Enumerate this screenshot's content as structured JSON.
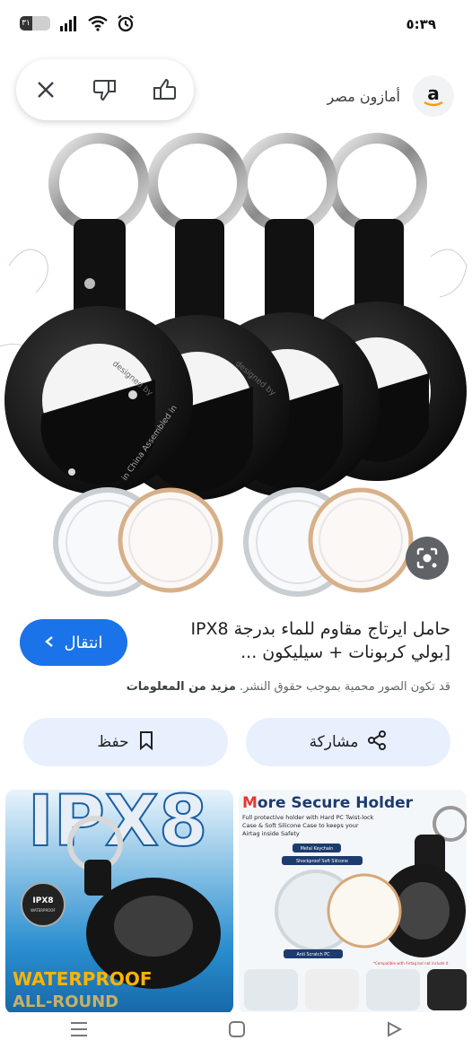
{
  "status_bar": {
    "time": "٥:٣٩",
    "battery": "٣١",
    "icons": [
      "battery-icon",
      "signal-icon",
      "wifi-icon",
      "alarm-icon"
    ]
  },
  "feedback": {
    "icons": [
      "close-icon",
      "thumbs-down-icon",
      "thumbs-up-icon"
    ]
  },
  "source": {
    "name": "أمازون مصر",
    "logo_letter": "a"
  },
  "result": {
    "title": "حامل ايرتاج مقاوم للماء بدرجة IPX8 [بولي كربونات + سيليكون ...",
    "visit_label": "انتقال",
    "copyright_text": "قد تكون الصور محمية بموجب حقوق النشر.",
    "more_info": "مزيد من المعلومات"
  },
  "actions": {
    "share_label": "مشاركة",
    "save_label": "حفظ"
  },
  "thumbnails": {
    "left": {
      "big_text": "IPX8",
      "badge": "IPX8",
      "badge_sub": "WATERPROOF",
      "label1": "WATERPROOF",
      "label2": "ALL-ROUND"
    },
    "right": {
      "heading_pre": "M",
      "heading": "ore Secure Holder",
      "line1": "Full protective holder with Hard PC Twist-lock",
      "line2": "Case & Soft Silicone Case to keeps your",
      "line3": "Airtag inside Safety",
      "callout1": "Metal Keychain",
      "callout2": "Shockproof Soft Silicone",
      "callout3": "Anti Scratch PC",
      "footnote": "*Compatible with Airtag but not include it"
    }
  },
  "hero_image": {
    "holder_text_1": "designed by",
    "holder_text_2": "in China Assembled in"
  },
  "colors": {
    "accent": "#1a73e8",
    "pill_bg": "#e8f0fe"
  }
}
